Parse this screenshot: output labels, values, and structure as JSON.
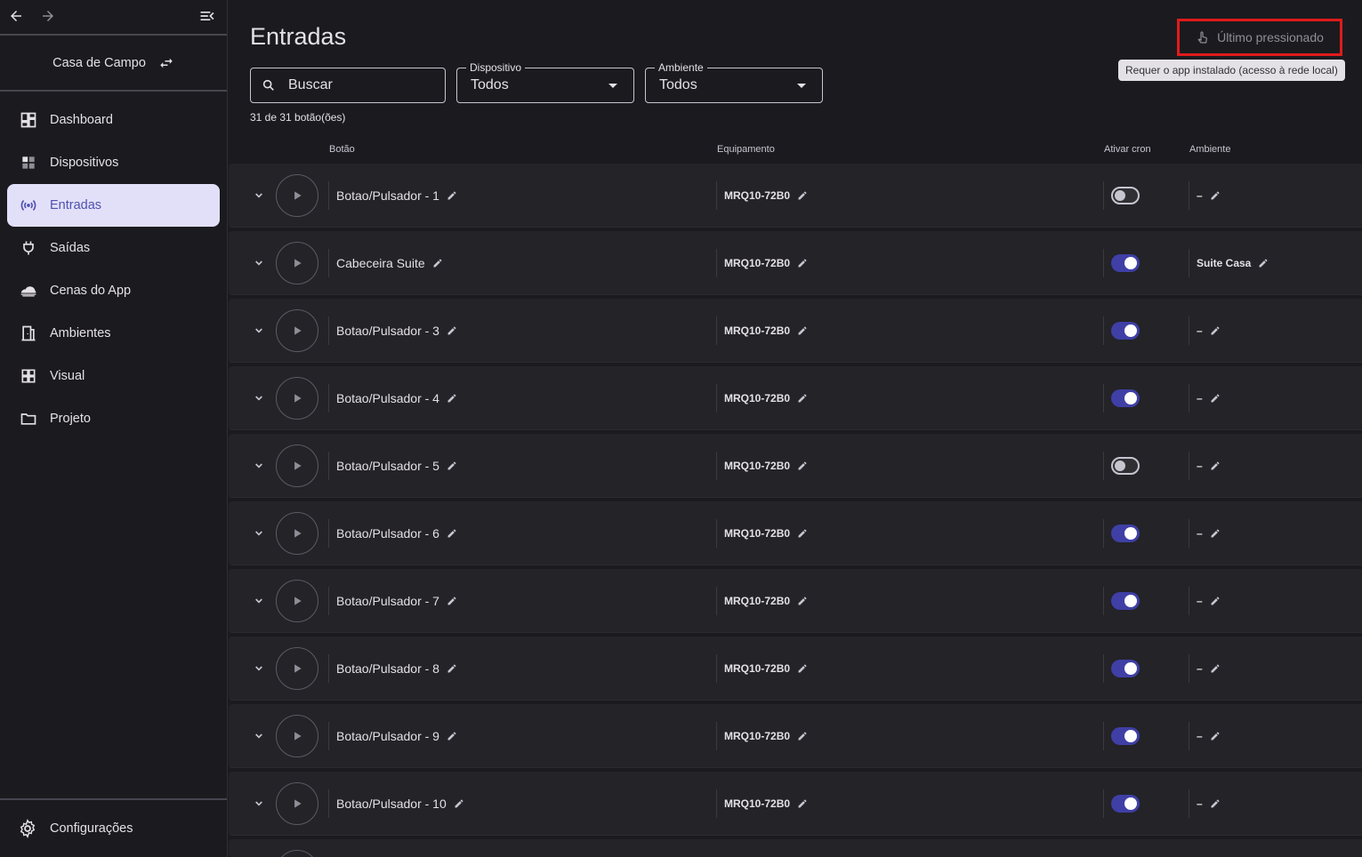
{
  "sidebar": {
    "home_name": "Casa de Campo",
    "items": [
      {
        "label": "Dashboard",
        "icon": "dashboard-icon",
        "active": false
      },
      {
        "label": "Dispositivos",
        "icon": "devices-icon",
        "active": false
      },
      {
        "label": "Entradas",
        "icon": "broadcast-icon",
        "active": true
      },
      {
        "label": "Saídas",
        "icon": "plug-icon",
        "active": false
      },
      {
        "label": "Cenas do App",
        "icon": "cloud-icon",
        "active": false
      },
      {
        "label": "Ambientes",
        "icon": "door-icon",
        "active": false
      },
      {
        "label": "Visual",
        "icon": "grid-icon",
        "active": false
      },
      {
        "label": "Projeto",
        "icon": "folder-icon",
        "active": false
      }
    ],
    "settings_label": "Configurações"
  },
  "header": {
    "title": "Entradas",
    "last_pressed_label": "Último pressionado",
    "tooltip": "Requer o app instalado (acesso à rede local)"
  },
  "filters": {
    "search_placeholder": "Buscar",
    "device_label": "Dispositivo",
    "device_value": "Todos",
    "room_label": "Ambiente",
    "room_value": "Todos",
    "count_text": "31 de 31 botão(ões)"
  },
  "table": {
    "columns": {
      "button": "Botão",
      "equipment": "Equipamento",
      "cron": "Ativar cron",
      "room": "Ambiente"
    },
    "rows": [
      {
        "name": "Botao/Pulsador - 1",
        "equipment": "MRQ10-72B0",
        "cron": false,
        "room": "–"
      },
      {
        "name": "Cabeceira Suite",
        "equipment": "MRQ10-72B0",
        "cron": true,
        "room": "Suite Casa"
      },
      {
        "name": "Botao/Pulsador - 3",
        "equipment": "MRQ10-72B0",
        "cron": true,
        "room": "–"
      },
      {
        "name": "Botao/Pulsador - 4",
        "equipment": "MRQ10-72B0",
        "cron": true,
        "room": "–"
      },
      {
        "name": "Botao/Pulsador - 5",
        "equipment": "MRQ10-72B0",
        "cron": false,
        "room": "–"
      },
      {
        "name": "Botao/Pulsador - 6",
        "equipment": "MRQ10-72B0",
        "cron": true,
        "room": "–"
      },
      {
        "name": "Botao/Pulsador - 7",
        "equipment": "MRQ10-72B0",
        "cron": true,
        "room": "–"
      },
      {
        "name": "Botao/Pulsador - 8",
        "equipment": "MRQ10-72B0",
        "cron": true,
        "room": "–"
      },
      {
        "name": "Botao/Pulsador - 9",
        "equipment": "MRQ10-72B0",
        "cron": true,
        "room": "–"
      },
      {
        "name": "Botao/Pulsador - 10",
        "equipment": "MRQ10-72B0",
        "cron": true,
        "room": "–"
      }
    ]
  },
  "colors": {
    "accent": "#4f51b0",
    "active_bg": "#e2e0f9",
    "toggle_on": "#3f3fa6",
    "highlight": "#e01b1b"
  }
}
